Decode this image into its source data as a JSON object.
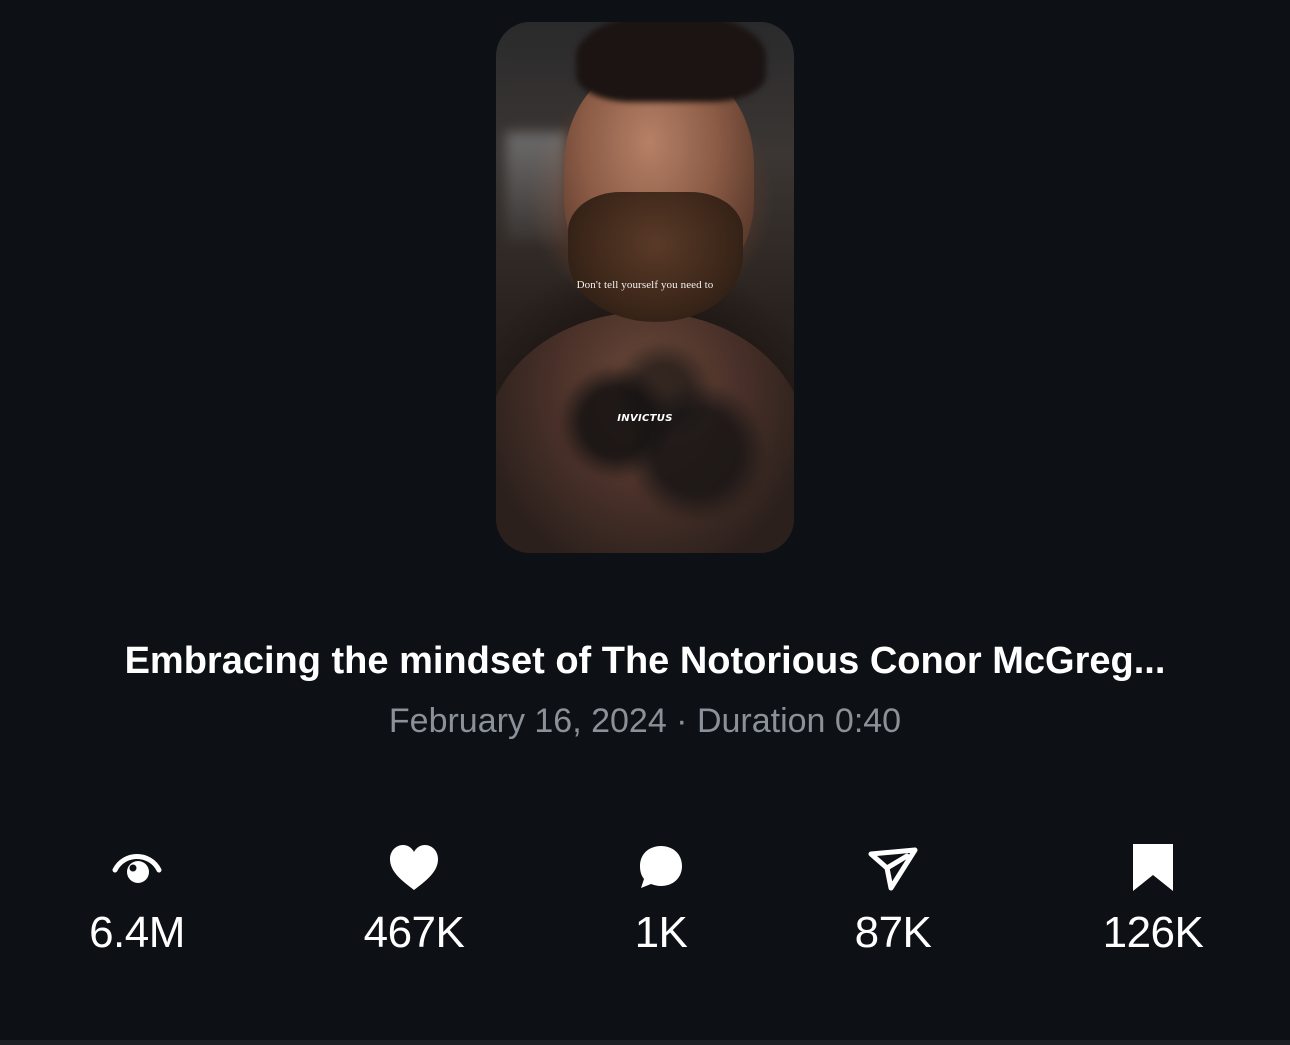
{
  "video": {
    "thumbnail_caption": "Don't tell yourself you need to",
    "watermark": "INVICTUS",
    "title": "Embracing the mindset of The Notorious Conor McGreg...",
    "meta": "February 16, 2024 · Duration 0:40"
  },
  "stats": [
    {
      "icon": "eye-icon",
      "value": "6.4M"
    },
    {
      "icon": "heart-icon",
      "value": "467K"
    },
    {
      "icon": "comment-icon",
      "value": "1K"
    },
    {
      "icon": "send-icon",
      "value": "87K"
    },
    {
      "icon": "bookmark-icon",
      "value": "126K"
    }
  ],
  "colors": {
    "background": "#0d1014",
    "text_primary": "#ffffff",
    "text_secondary": "#8b9198"
  }
}
